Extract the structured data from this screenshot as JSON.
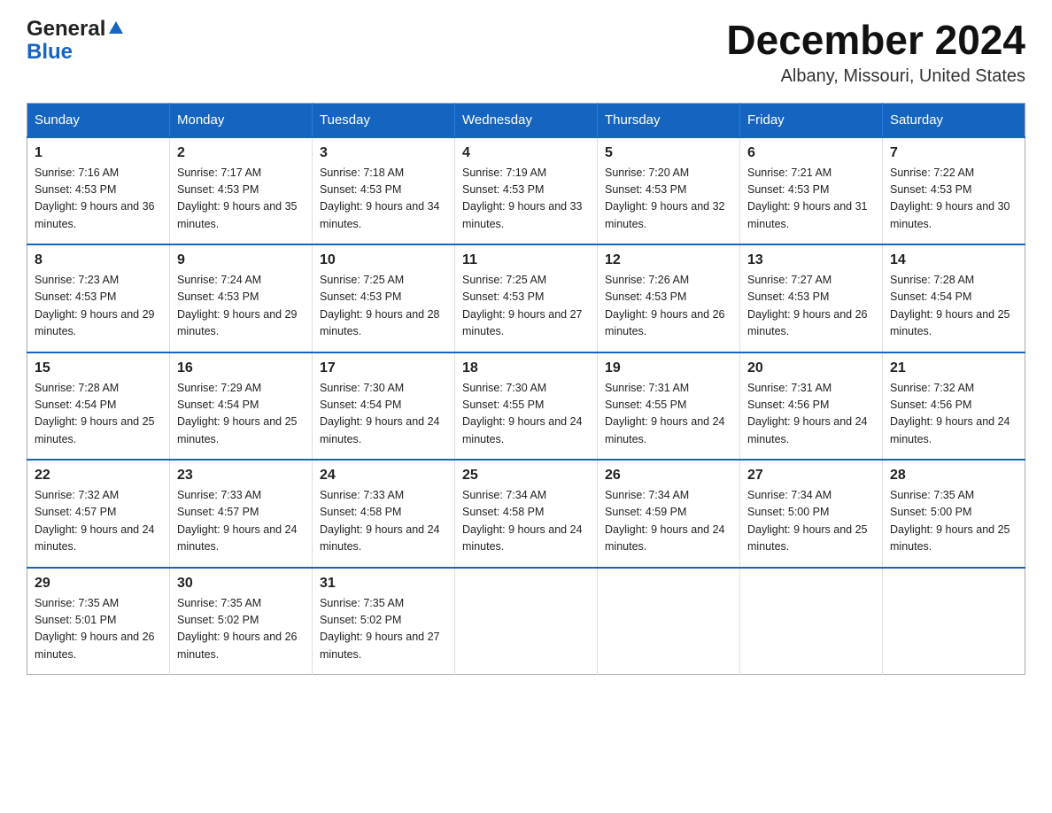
{
  "header": {
    "logo_general": "General",
    "logo_blue": "Blue",
    "title": "December 2024",
    "subtitle": "Albany, Missouri, United States"
  },
  "days_of_week": [
    "Sunday",
    "Monday",
    "Tuesday",
    "Wednesday",
    "Thursday",
    "Friday",
    "Saturday"
  ],
  "weeks": [
    [
      {
        "day": "1",
        "sunrise": "7:16 AM",
        "sunset": "4:53 PM",
        "daylight": "9 hours and 36 minutes."
      },
      {
        "day": "2",
        "sunrise": "7:17 AM",
        "sunset": "4:53 PM",
        "daylight": "9 hours and 35 minutes."
      },
      {
        "day": "3",
        "sunrise": "7:18 AM",
        "sunset": "4:53 PM",
        "daylight": "9 hours and 34 minutes."
      },
      {
        "day": "4",
        "sunrise": "7:19 AM",
        "sunset": "4:53 PM",
        "daylight": "9 hours and 33 minutes."
      },
      {
        "day": "5",
        "sunrise": "7:20 AM",
        "sunset": "4:53 PM",
        "daylight": "9 hours and 32 minutes."
      },
      {
        "day": "6",
        "sunrise": "7:21 AM",
        "sunset": "4:53 PM",
        "daylight": "9 hours and 31 minutes."
      },
      {
        "day": "7",
        "sunrise": "7:22 AM",
        "sunset": "4:53 PM",
        "daylight": "9 hours and 30 minutes."
      }
    ],
    [
      {
        "day": "8",
        "sunrise": "7:23 AM",
        "sunset": "4:53 PM",
        "daylight": "9 hours and 29 minutes."
      },
      {
        "day": "9",
        "sunrise": "7:24 AM",
        "sunset": "4:53 PM",
        "daylight": "9 hours and 29 minutes."
      },
      {
        "day": "10",
        "sunrise": "7:25 AM",
        "sunset": "4:53 PM",
        "daylight": "9 hours and 28 minutes."
      },
      {
        "day": "11",
        "sunrise": "7:25 AM",
        "sunset": "4:53 PM",
        "daylight": "9 hours and 27 minutes."
      },
      {
        "day": "12",
        "sunrise": "7:26 AM",
        "sunset": "4:53 PM",
        "daylight": "9 hours and 26 minutes."
      },
      {
        "day": "13",
        "sunrise": "7:27 AM",
        "sunset": "4:53 PM",
        "daylight": "9 hours and 26 minutes."
      },
      {
        "day": "14",
        "sunrise": "7:28 AM",
        "sunset": "4:54 PM",
        "daylight": "9 hours and 25 minutes."
      }
    ],
    [
      {
        "day": "15",
        "sunrise": "7:28 AM",
        "sunset": "4:54 PM",
        "daylight": "9 hours and 25 minutes."
      },
      {
        "day": "16",
        "sunrise": "7:29 AM",
        "sunset": "4:54 PM",
        "daylight": "9 hours and 25 minutes."
      },
      {
        "day": "17",
        "sunrise": "7:30 AM",
        "sunset": "4:54 PM",
        "daylight": "9 hours and 24 minutes."
      },
      {
        "day": "18",
        "sunrise": "7:30 AM",
        "sunset": "4:55 PM",
        "daylight": "9 hours and 24 minutes."
      },
      {
        "day": "19",
        "sunrise": "7:31 AM",
        "sunset": "4:55 PM",
        "daylight": "9 hours and 24 minutes."
      },
      {
        "day": "20",
        "sunrise": "7:31 AM",
        "sunset": "4:56 PM",
        "daylight": "9 hours and 24 minutes."
      },
      {
        "day": "21",
        "sunrise": "7:32 AM",
        "sunset": "4:56 PM",
        "daylight": "9 hours and 24 minutes."
      }
    ],
    [
      {
        "day": "22",
        "sunrise": "7:32 AM",
        "sunset": "4:57 PM",
        "daylight": "9 hours and 24 minutes."
      },
      {
        "day": "23",
        "sunrise": "7:33 AM",
        "sunset": "4:57 PM",
        "daylight": "9 hours and 24 minutes."
      },
      {
        "day": "24",
        "sunrise": "7:33 AM",
        "sunset": "4:58 PM",
        "daylight": "9 hours and 24 minutes."
      },
      {
        "day": "25",
        "sunrise": "7:34 AM",
        "sunset": "4:58 PM",
        "daylight": "9 hours and 24 minutes."
      },
      {
        "day": "26",
        "sunrise": "7:34 AM",
        "sunset": "4:59 PM",
        "daylight": "9 hours and 24 minutes."
      },
      {
        "day": "27",
        "sunrise": "7:34 AM",
        "sunset": "5:00 PM",
        "daylight": "9 hours and 25 minutes."
      },
      {
        "day": "28",
        "sunrise": "7:35 AM",
        "sunset": "5:00 PM",
        "daylight": "9 hours and 25 minutes."
      }
    ],
    [
      {
        "day": "29",
        "sunrise": "7:35 AM",
        "sunset": "5:01 PM",
        "daylight": "9 hours and 26 minutes."
      },
      {
        "day": "30",
        "sunrise": "7:35 AM",
        "sunset": "5:02 PM",
        "daylight": "9 hours and 26 minutes."
      },
      {
        "day": "31",
        "sunrise": "7:35 AM",
        "sunset": "5:02 PM",
        "daylight": "9 hours and 27 minutes."
      },
      null,
      null,
      null,
      null
    ]
  ]
}
